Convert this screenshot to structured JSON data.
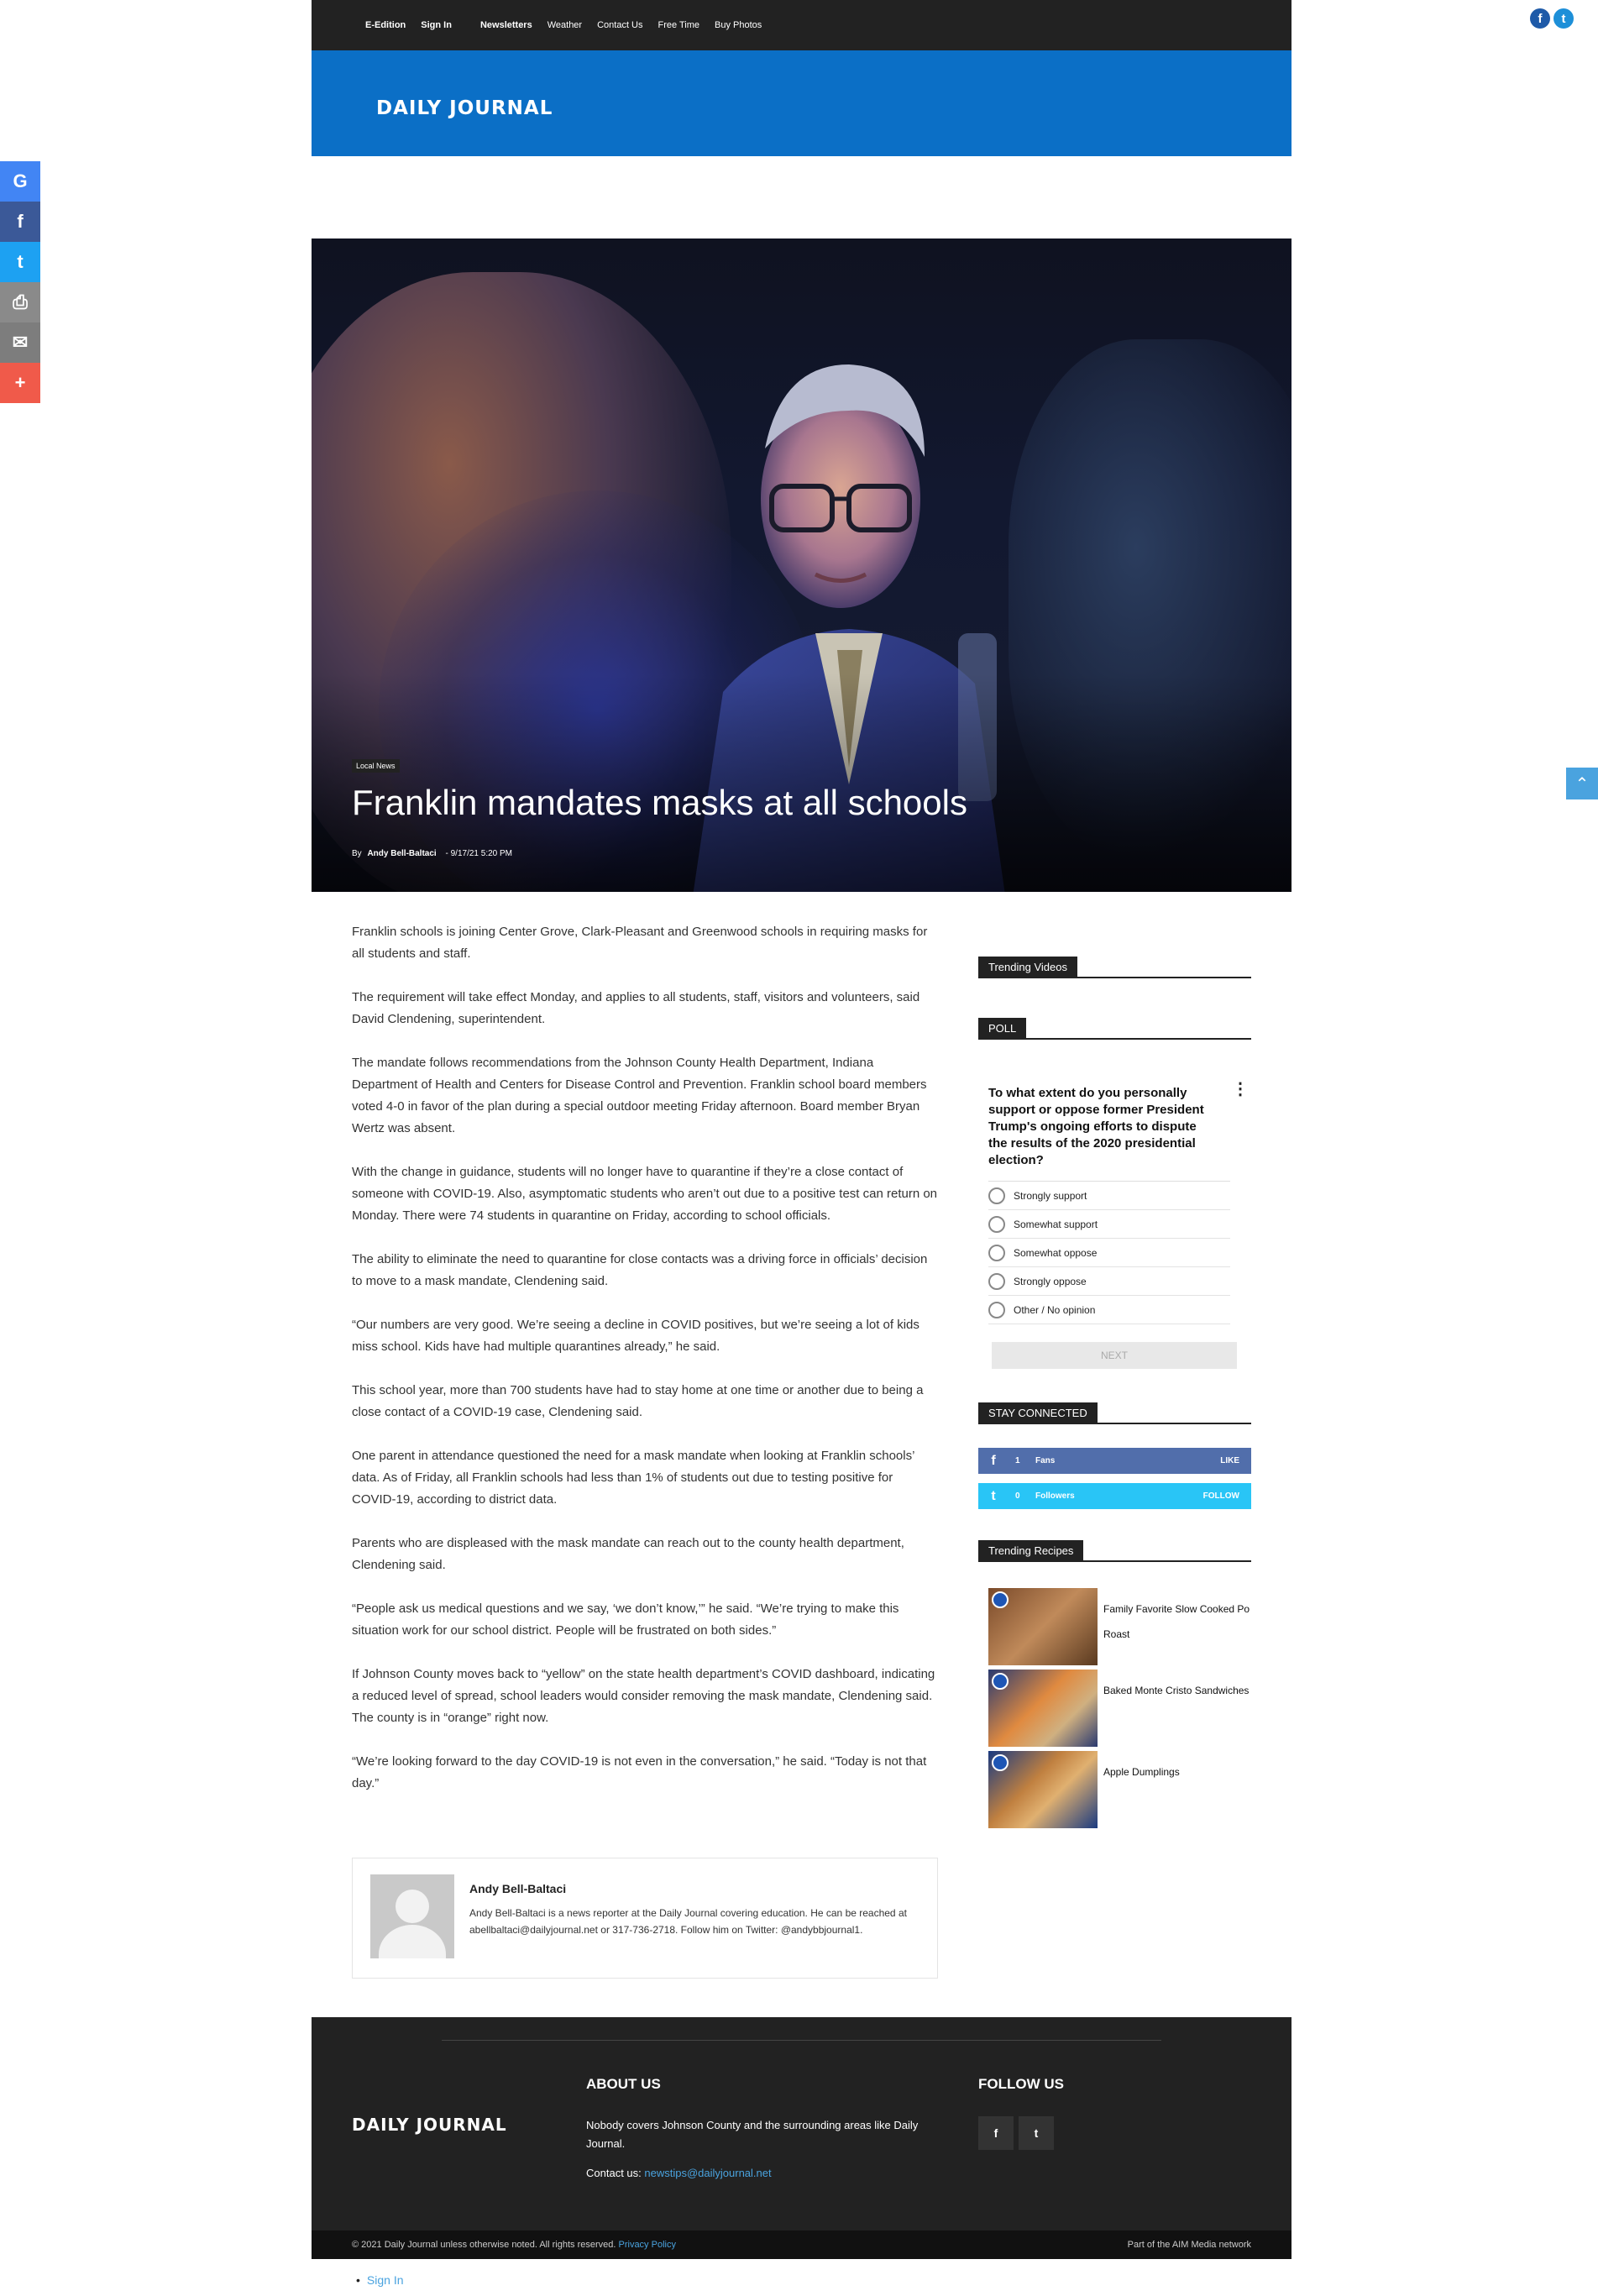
{
  "top_nav": {
    "items": [
      {
        "label": "E-Edition"
      },
      {
        "label": "Sign In"
      },
      {
        "label": "Newsletters"
      },
      {
        "label": "Weather"
      },
      {
        "label": "Contact Us"
      },
      {
        "label": "Free Time"
      },
      {
        "label": "Buy Photos"
      }
    ]
  },
  "brand": {
    "logo_text": "DAILY JOURNAL",
    "banner_color": "#0b6fc6"
  },
  "share_bar": [
    {
      "icon": "google-icon",
      "glyph": "G",
      "color": "#4285f4"
    },
    {
      "icon": "facebook-icon",
      "glyph": "f",
      "color": "#3b5998"
    },
    {
      "icon": "twitter-icon",
      "glyph": "t",
      "color": "#1da1f2"
    },
    {
      "icon": "print-icon",
      "glyph": "⎙",
      "color": "#8a8a8a"
    },
    {
      "icon": "email-icon",
      "glyph": "✉",
      "color": "#7d7d7d"
    },
    {
      "icon": "more-icon",
      "glyph": "+",
      "color": "#f05a4a"
    }
  ],
  "article": {
    "category": "Local News",
    "title": "Franklin mandates masks at all schools",
    "by_label": "By",
    "author": "Andy Bell-Baltaci",
    "separator": "-",
    "date": "9/17/21 5:20 PM",
    "paragraphs": [
      "Franklin schools is joining Center Grove, Clark-Pleasant and Greenwood schools in requiring masks for all students and staff.",
      "The requirement will take effect Monday, and applies to all students, staff, visitors and volunteers, said David Clendening, superintendent.",
      "The mandate follows recommendations from the Johnson County Health Department, Indiana Department of Health and Centers for Disease Control and Prevention. Franklin school board members voted 4-0 in favor of the plan during a special outdoor meeting Friday afternoon. Board member Bryan Wertz was absent.",
      "With the change in guidance, students will no longer have to quarantine if they’re a close contact of someone with COVID-19. Also, asymptomatic students who aren’t out due to a positive test can return on Monday. There were 74 students in quarantine on Friday, according to school officials.",
      "The ability to eliminate the need to quarantine for close contacts was a driving force in officials’ decision to move to a mask mandate, Clendening said.",
      "“Our numbers are very good. We’re seeing a decline in COVID positives, but we’re seeing a lot of kids miss school. Kids have had multiple quarantines already,” he said.",
      "This school year, more than 700 students have had to stay home at one time or another due to being a close contact of a COVID-19 case, Clendening said.",
      "One parent in attendance questioned the need for a mask mandate when looking at Franklin schools’ data. As of Friday, all Franklin schools had less than 1% of students out due to testing positive for COVID-19, according to district data.",
      "Parents who are displeased with the mask mandate can reach out to the county health department, Clendening said.",
      "“People ask us medical questions and we say, ‘we don’t know,’” he said. “We’re trying to make this situation work for our school district. People will be frustrated on both sides.”",
      "If Johnson County moves back to “yellow” on the state health department’s COVID dashboard, indicating a reduced level of spread, school leaders would consider removing the mask mandate, Clendening said. The county is in “orange” right now.",
      "“We’re looking forward to the day COVID-19 is not even in the conversation,” he said. “Today is not that day.”"
    ]
  },
  "author_box": {
    "name": "Andy Bell-Baltaci",
    "bio": "Andy Bell-Baltaci is a news reporter at the Daily Journal covering education. He can be reached at abellbaltaci@dailyjournal.net or 317-736-2718. Follow him on Twitter: @andybbjournal1."
  },
  "sidebar": {
    "trending_videos_title": "Trending Videos",
    "poll_title": "POLL",
    "poll_question": "To what extent do you personally support or oppose former President Trump's ongoing efforts to dispute the results of the 2020 presidential election?",
    "poll_options": [
      "Strongly support",
      "Somewhat support",
      "Somewhat oppose",
      "Strongly oppose",
      "Other / No opinion"
    ],
    "poll_next": "NEXT",
    "stay_connected_title": "STAY CONNECTED",
    "social": [
      {
        "network": "facebook",
        "icon": "facebook-icon",
        "glyph": "f",
        "count": "1",
        "label": "Fans",
        "action": "LIKE",
        "color": "#516eab"
      },
      {
        "network": "twitter",
        "icon": "twitter-icon",
        "glyph": "t",
        "count": "0",
        "label": "Followers",
        "action": "FOLLOW",
        "color": "#29c5f6"
      }
    ],
    "trending_recipes_title": "Trending Recipes",
    "recipes": [
      {
        "title_line1": "Family Favorite Slow Cooked Po",
        "title_line2": "Roast"
      },
      {
        "title_line1": "Baked Monte Cristo Sandwiches",
        "title_line2": ""
      },
      {
        "title_line1": "Apple Dumplings",
        "title_line2": ""
      }
    ]
  },
  "footer": {
    "logo_text": "DAILY JOURNAL",
    "about_title": "ABOUT US",
    "about_text": "Nobody covers Johnson County and the surrounding areas like Daily Journal.",
    "contact_label": "Contact us:",
    "contact_email": "newstips@dailyjournal.net",
    "follow_title": "FOLLOW US",
    "copyright": "© 2021 Daily Journal unless otherwise noted. All rights reserved.",
    "privacy": "Privacy Policy",
    "network": "Part of the AIM Media network"
  },
  "bottom_link": {
    "label": "Sign In"
  }
}
